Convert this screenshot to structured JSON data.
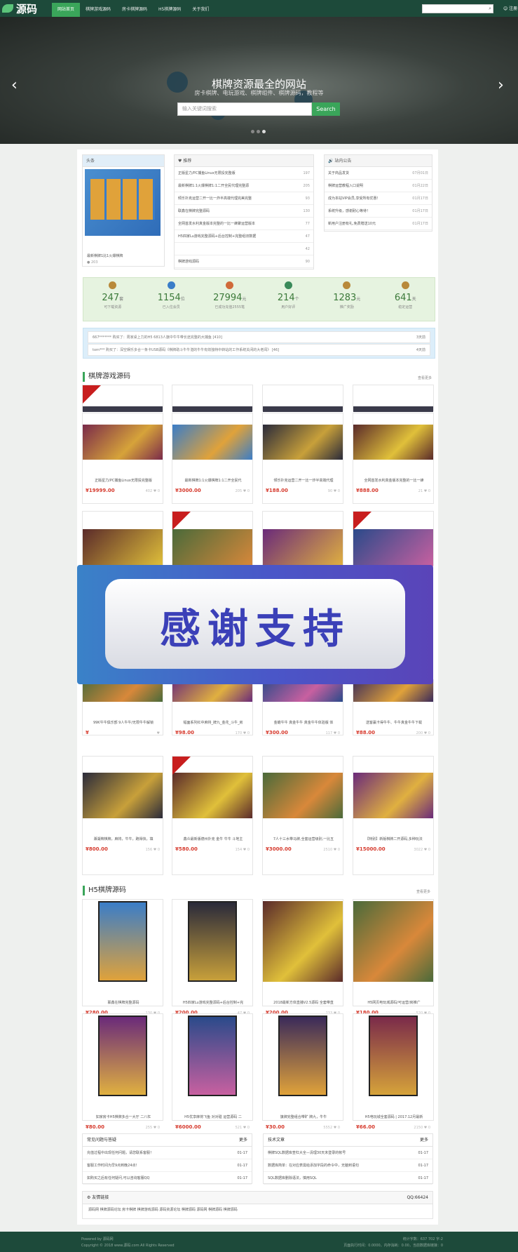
{
  "header": {
    "logo": "源码",
    "nav": [
      "网站首页",
      "棋牌游戏源码",
      "房卡棋牌源码",
      "H5棋牌源码",
      "关于我们"
    ],
    "search_icon": "search-icon",
    "login": "注册"
  },
  "banner": {
    "title": "棋牌资源最全的网站",
    "subtitle": "房卡棋牌、电玩游戏、棋牌组件、棋牌源码，教程等",
    "placeholder": "输入关键词搜索",
    "button": "Search"
  },
  "headline": {
    "label": "头条",
    "caption": "最新棋牌1比1火爆棋牌",
    "views": "203"
  },
  "recommend": {
    "label": "推荐",
    "items": [
      {
        "t": "正版星力/PC捕鱼Linux无限投完整版",
        "n": "197"
      },
      {
        "t": "最新棋牌1:1火爆棋牌1:1二开全民代理完整源",
        "n": "205"
      },
      {
        "t": "倾乐扑克运营二开一比一炸半高端代理完美完整",
        "n": "93"
      },
      {
        "t": "联鑫在棋牌完整源码",
        "n": "130"
      },
      {
        "t": "全网首发水利真金版本完整的一比一蜂聚运营版本",
        "n": "77"
      },
      {
        "t": "H5四家Lu游戏完整源码+后台控制+完整组旧数据",
        "n": "47"
      },
      {
        "t": "",
        "n": "42"
      },
      {
        "t": "棋牌游戏源码",
        "n": "90"
      }
    ]
  },
  "notice": {
    "label": "站内公告",
    "items": [
      {
        "t": "关于商品发货",
        "d": "07月01日"
      },
      {
        "t": "棋牌运营教程入口说明",
        "d": "01月22日"
      },
      {
        "t": "成为本站VIP会员,享受所有优惠！",
        "d": "01月17日"
      },
      {
        "t": "系统升级，感谢耐心等待！",
        "d": "01月17日"
      },
      {
        "t": "新用户注册有礼,免费赠送10元",
        "d": "01月17日"
      }
    ]
  },
  "stats": [
    {
      "num": "247",
      "unit": "套",
      "label": "可下载资源"
    },
    {
      "num": "1154",
      "unit": "位",
      "label": "已入住会员"
    },
    {
      "num": "27994",
      "unit": "元",
      "label": "已成功充值2555笔"
    },
    {
      "num": "214",
      "unit": "个",
      "label": "用户好评"
    },
    {
      "num": "1283",
      "unit": "元",
      "label": "推广奖励"
    },
    {
      "num": "641",
      "unit": "天",
      "label": "稳定运营"
    }
  ],
  "buys": [
    {
      "t": "667******* 购买了：周家桌上力的H5 6813人旗中牛牛带长途完整的大捕鱼 [410]",
      "d": "3天前"
    },
    {
      "t": "tom*** 购买了：深空娱乐多合一条卡USB源码《棋牌助斗牛牛湛的牛牛有效独特中转站的工作系统关闭的大老闻》 [46]",
      "d": "4天前"
    }
  ],
  "section1": {
    "title": "棋牌游戏源码",
    "more": "查看更多"
  },
  "cards1": [
    {
      "t": "正版星力/PC捕鱼Linux无限投完整版",
      "p": "19999.00",
      "v": "402",
      "c": "0"
    },
    {
      "t": "最新棋牌1:1火爆棋牌1:1二开全民代",
      "p": "3000.00",
      "v": "205",
      "c": "0"
    },
    {
      "t": "倾乐扑克运营二开一比一炸半高端代理",
      "p": "188.00",
      "v": "90",
      "c": "0"
    },
    {
      "t": "全网首发水利真金版本完整的一比一蜂",
      "p": "888.00",
      "v": "21",
      "c": "0"
    }
  ],
  "cards3": [
    {
      "t": "99K牛牛俱乐部 9人牛牛/无限牛牛解锁",
      "p": "",
      "v": "",
      "c": ""
    },
    {
      "t": "幅面系列红中麻将_牌九_金花_斗牛_房",
      "p": "98.00",
      "v": "170",
      "c": "0"
    },
    {
      "t": "金蟾牛牛 真金牛牛 真金牛牛体验版 体",
      "p": "300.00",
      "v": "117",
      "c": "0"
    },
    {
      "t": "送客赢卡得牛牛、牛牛真金牛牛下载",
      "p": "88.00",
      "v": "200",
      "c": "0"
    }
  ],
  "cards4": [
    {
      "t": "湘湖牌棋牌，麻将，牛牛，跑得快，填",
      "p": "800.00",
      "v": "156",
      "c": "0"
    },
    {
      "t": "鑫众最新版德州扑克 金牛 牛牛 斗地主",
      "p": "580.00",
      "v": "154",
      "c": "0"
    },
    {
      "t": "7人十三水带马牌,全套运营级别,一比五",
      "p": "3000.00",
      "v": "2510",
      "c": "0"
    },
    {
      "t": "【特别】新版棋牌二开源码,多种玩法",
      "p": "15000.00",
      "v": "3022",
      "c": "0"
    }
  ],
  "promo": {
    "text": "感谢支持"
  },
  "section2": {
    "title": "H5棋牌源码",
    "more": "查看更多"
  },
  "cardsH1": [
    {
      "t": "联鑫在棋牌完整源码",
      "p": "280.00",
      "v": "130",
      "c": "0"
    },
    {
      "t": "H5四家Lu游戏完整源码+后台控制+完",
      "p": "200.00",
      "v": "47",
      "c": "0"
    },
    {
      "t": "2018最新方体直播V2.5源码 全套带直",
      "p": "200.00",
      "v": "233",
      "c": "0"
    },
    {
      "t": "H5网页电玩城源码/可运营/房推广",
      "p": "180.00",
      "v": "520",
      "c": "0"
    }
  ],
  "cardsH2": [
    {
      "t": "如家房卡H5棋牌多合一大厅 二八杠",
      "p": "80.00",
      "v": "255",
      "c": "0"
    },
    {
      "t": "H5优享麻将飞鱼 对对碰 运营源码 二",
      "p": "6000.00",
      "v": "521",
      "c": "0"
    },
    {
      "t": "旗牌完整组合带旷 牌九，牛牛",
      "p": "30.00",
      "v": "5552",
      "c": "0"
    },
    {
      "t": "H5电玩城全套源码 | 2017.12月最新",
      "p": "66.00",
      "v": "2150",
      "c": "0"
    }
  ],
  "faq": {
    "title": "常见问题与答疑",
    "more": "更多",
    "items": [
      {
        "t": "充值过程中出现任何问题，请您联系客服！",
        "d": "01-17"
      },
      {
        "t": "客服工作时间为早9点到晚24点！",
        "d": "01-17"
      },
      {
        "t": "如购买之后有任何疑问,可以咨询客服QQ",
        "d": "01-17"
      }
    ]
  },
  "tech": {
    "title": "技术文章",
    "more": "更多",
    "items": [
      {
        "t": "棋牌SQL数据库查杠大全—清理30天未登录的帐号",
        "d": "01-17"
      },
      {
        "t": "数据库简单：在对应表需给添加字段的命令中，无脑到语句",
        "d": "01-17"
      },
      {
        "t": "SQL数据库删除语法，慎用SQL",
        "d": "01-17"
      }
    ]
  },
  "links": {
    "title": "友情链接",
    "qq": "QQ:66424",
    "items": "源码网 棋牌源码论坛 房卡棋牌 棋牌游戏源码 源码资源论坛 棋牌源码 源码网 棋牌源码 棋牌源码"
  },
  "footer": {
    "left1": "Powered by 源码网",
    "left2": "Copyright © 2018 www.源码.com All Rights Reserved",
    "right1": "统计字数：637 702 字-2",
    "right2": "页面执行时间：0.0000，内存消耗：0.00，当前数据库链接：0"
  }
}
